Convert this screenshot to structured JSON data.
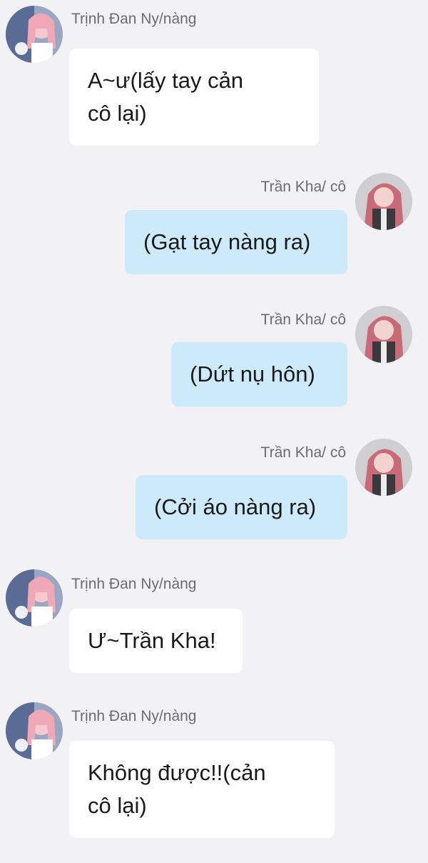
{
  "messages": [
    {
      "sender": "Trịnh Đan Ny/nàng",
      "side": "left",
      "lines": [
        "A~ư(lấy tay cản",
        "cô lại)"
      ],
      "avatar_icon": "avatar-nang-icon"
    },
    {
      "sender": "Trần Kha/ cô",
      "side": "right",
      "lines": [
        "(Gạt tay nàng ra)"
      ],
      "avatar_icon": "avatar-co-icon"
    },
    {
      "sender": "Trần Kha/ cô",
      "side": "right",
      "lines": [
        "(Dứt nụ hôn)"
      ],
      "avatar_icon": "avatar-co-icon"
    },
    {
      "sender": "Trần Kha/ cô",
      "side": "right",
      "lines": [
        "(Cởi áo nàng ra)"
      ],
      "avatar_icon": "avatar-co-icon"
    },
    {
      "sender": "Trịnh Đan Ny/nàng",
      "side": "left",
      "lines": [
        "Ư~Trần Kha!"
      ],
      "avatar_icon": "avatar-nang-icon"
    },
    {
      "sender": "Trịnh Đan Ny/nàng",
      "side": "left",
      "lines": [
        "Không được!!(cản",
        "cô lại)"
      ],
      "avatar_icon": "avatar-nang-icon"
    }
  ],
  "colors": {
    "background": "#f2f2f4",
    "left_bubble": "#ffffff",
    "right_bubble": "#cdeafb",
    "name_text": "#6c6c70",
    "message_text": "#1a1a1a"
  }
}
